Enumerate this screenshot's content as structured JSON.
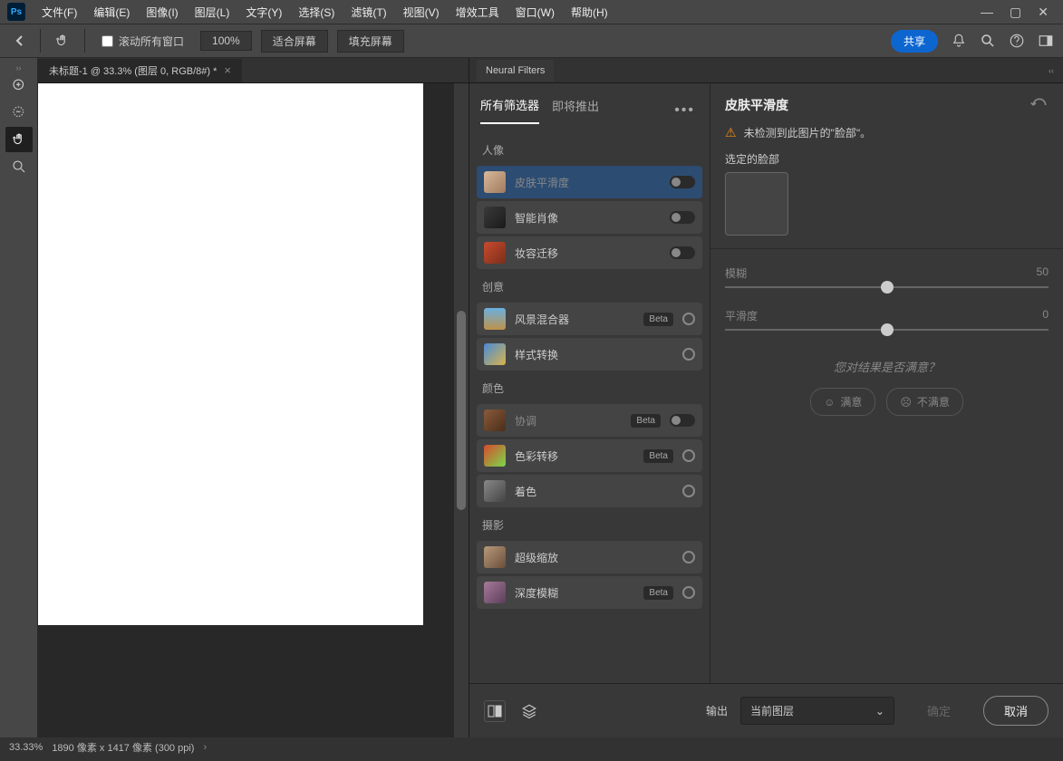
{
  "menu": {
    "items": [
      "文件(F)",
      "编辑(E)",
      "图像(I)",
      "图层(L)",
      "文字(Y)",
      "选择(S)",
      "滤镜(T)",
      "视图(V)",
      "增效工具",
      "窗口(W)",
      "帮助(H)"
    ]
  },
  "optbar": {
    "scroll_all_label": "滚动所有窗口",
    "zoom": "100%",
    "fit_screen": "适合屏幕",
    "fill_screen": "填充屏幕",
    "share": "共享"
  },
  "doc": {
    "tab": "未标题-1 @ 33.3% (图层 0, RGB/8#) *"
  },
  "panel_tab": "Neural Filters",
  "filter_tabs": {
    "all": "所有筛选器",
    "upcoming": "即将推出"
  },
  "categories": {
    "portrait": "人像",
    "creative": "创意",
    "color": "颜色",
    "photo": "摄影"
  },
  "filters": {
    "skin": "皮肤平滑度",
    "smart_portrait": "智能肖像",
    "makeup": "妆容迁移",
    "landscape": "风景混合器",
    "style": "样式转换",
    "harmonize": "协调",
    "color_transfer": "色彩转移",
    "colorize": "着色",
    "super_zoom": "超级缩放",
    "depth_blur": "深度模糊",
    "beta": "Beta"
  },
  "settings": {
    "title": "皮肤平滑度",
    "warn": "未检测到此图片的\"脸部\"。",
    "selected_face": "选定的脸部",
    "blur_label": "模糊",
    "blur_value": "50",
    "smooth_label": "平滑度",
    "smooth_value": "0",
    "feedback_q": "您对结果是否满意？",
    "yes": "满意",
    "no": "不满意"
  },
  "output": {
    "label": "输出",
    "selected": "当前图层",
    "ok": "确定",
    "cancel": "取消"
  },
  "status": {
    "zoom": "33.33%",
    "dims": "1890 像素 x 1417 像素 (300 ppi)"
  }
}
